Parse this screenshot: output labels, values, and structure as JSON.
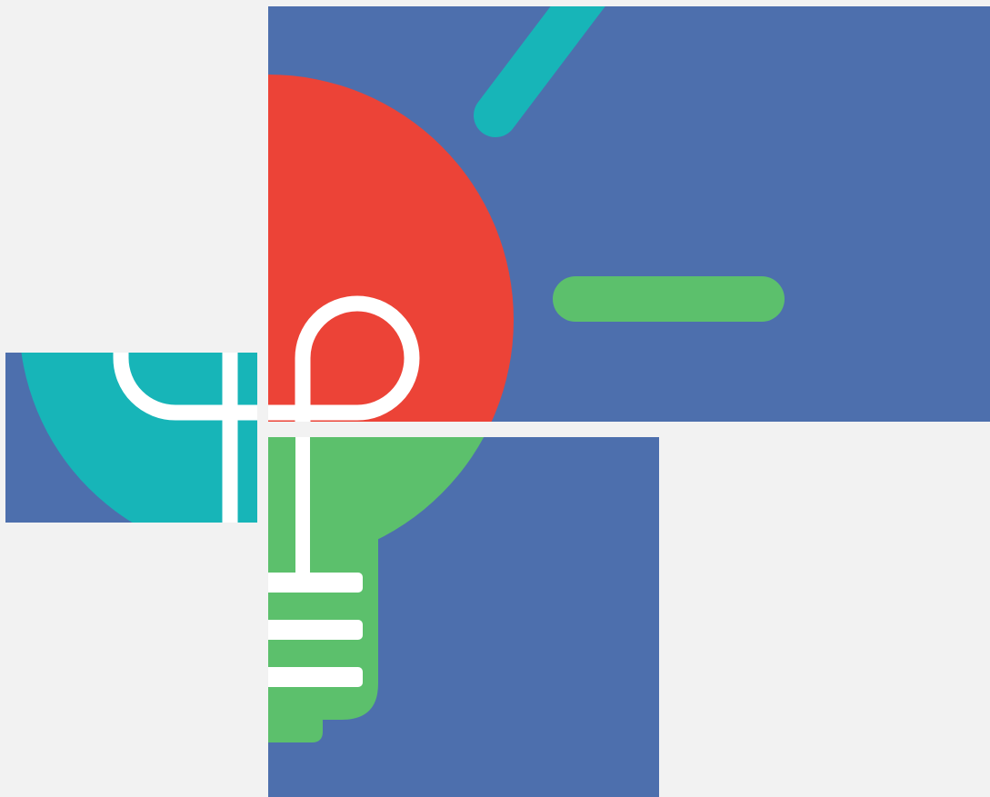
{
  "illustration": {
    "subject": "lightbulb-puzzle-icon",
    "pieces": [
      "top-right-tile",
      "left-tile",
      "bottom-tile"
    ],
    "colors": {
      "background": "#f2f2f2",
      "tile_blue": "#4d6fad",
      "bulb_red": "#ec4337",
      "bulb_teal": "#17b5b8",
      "bulb_green": "#5cc06c",
      "ray_teal": "#17b5b8",
      "ray_green": "#5cc06c",
      "filament_white": "#ffffff"
    }
  }
}
